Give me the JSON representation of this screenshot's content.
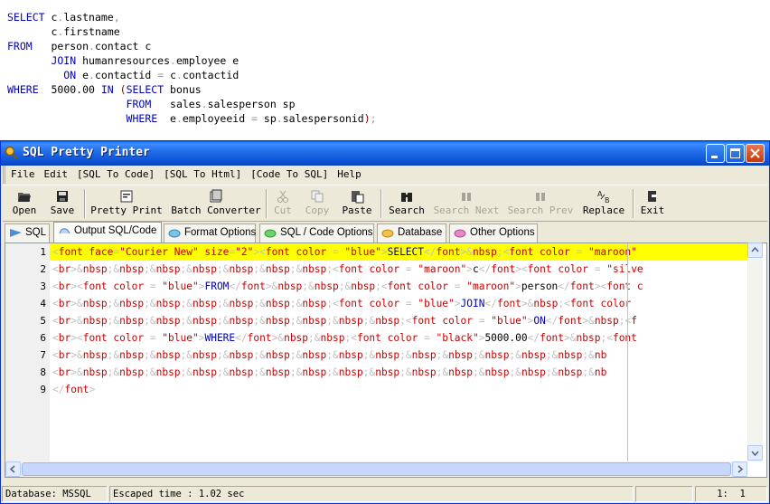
{
  "sql_preview": {
    "lines": [
      [
        {
          "c": "sq-kw",
          "t": "SELECT "
        },
        {
          "c": "sq-id",
          "t": "c"
        },
        {
          "c": "sq-gr",
          "t": "."
        },
        {
          "c": "sq-id",
          "t": "lastname"
        },
        {
          "c": "sq-gr",
          "t": ","
        }
      ],
      [
        {
          "c": "sq-id",
          "t": "       c"
        },
        {
          "c": "sq-gr",
          "t": "."
        },
        {
          "c": "sq-id",
          "t": "firstname"
        }
      ],
      [
        {
          "c": "sq-kw",
          "t": "FROM   "
        },
        {
          "c": "sq-id",
          "t": "person"
        },
        {
          "c": "sq-gr",
          "t": "."
        },
        {
          "c": "sq-id",
          "t": "contact c"
        }
      ],
      [
        {
          "c": "sq-kw",
          "t": "       JOIN "
        },
        {
          "c": "sq-id",
          "t": "humanresources"
        },
        {
          "c": "sq-gr",
          "t": "."
        },
        {
          "c": "sq-id",
          "t": "employee e"
        }
      ],
      [
        {
          "c": "sq-kw",
          "t": "         ON "
        },
        {
          "c": "sq-id",
          "t": "e"
        },
        {
          "c": "sq-gr",
          "t": "."
        },
        {
          "c": "sq-id",
          "t": "contactid "
        },
        {
          "c": "sq-gr",
          "t": "= "
        },
        {
          "c": "sq-id",
          "t": "c"
        },
        {
          "c": "sq-gr",
          "t": "."
        },
        {
          "c": "sq-id",
          "t": "contactid"
        }
      ],
      [
        {
          "c": "sq-kw",
          "t": "WHERE  "
        },
        {
          "c": "sq-id",
          "t": "5000.00 "
        },
        {
          "c": "sq-kw",
          "t": "IN "
        },
        {
          "c": "sq-mr",
          "t": "("
        },
        {
          "c": "sq-kw",
          "t": "SELECT "
        },
        {
          "c": "sq-id",
          "t": "bonus"
        }
      ],
      [
        {
          "c": "sq-kw",
          "t": "                   FROM   "
        },
        {
          "c": "sq-id",
          "t": "sales"
        },
        {
          "c": "sq-gr",
          "t": "."
        },
        {
          "c": "sq-id",
          "t": "salesperson sp"
        }
      ],
      [
        {
          "c": "sq-kw",
          "t": "                   WHERE  "
        },
        {
          "c": "sq-id",
          "t": "e"
        },
        {
          "c": "sq-gr",
          "t": "."
        },
        {
          "c": "sq-id",
          "t": "employeeid "
        },
        {
          "c": "sq-gr",
          "t": "= "
        },
        {
          "c": "sq-id",
          "t": "sp"
        },
        {
          "c": "sq-gr",
          "t": "."
        },
        {
          "c": "sq-id",
          "t": "salespersonid"
        },
        {
          "c": "sq-mr",
          "t": ")"
        },
        {
          "c": "sq-gr",
          "t": ";"
        }
      ]
    ]
  },
  "window": {
    "title": "SQL Pretty Printer",
    "menu": [
      "File",
      "Edit",
      "[SQL To Code]",
      "[SQL To Html]",
      "[Code To SQL]",
      "Help"
    ],
    "toolbar": {
      "open": "Open",
      "save": "Save",
      "pretty_print": "Pretty Print",
      "batch_converter": "Batch Converter",
      "cut": "Cut",
      "copy": "Copy",
      "paste": "Paste",
      "search": "Search",
      "search_next": "Search Next",
      "search_prev": "Search Prev",
      "replace": "Replace",
      "exit": "Exit"
    },
    "tabs": [
      "SQL",
      "Output SQL/Code",
      "Format Options",
      "SQL / Code Options",
      "Database",
      "Other Options"
    ],
    "active_tab": "Output SQL/Code",
    "line_numbers": [
      "1",
      "2",
      "3",
      "4",
      "5",
      "6",
      "7",
      "8",
      "9"
    ],
    "code_lines": [
      [
        {
          "c": "t",
          "t": "<"
        },
        {
          "c": "s",
          "t": "font face"
        },
        {
          "c": "t",
          "t": "="
        },
        {
          "c": "s",
          "t": "\"Courier New\" size"
        },
        {
          "c": "t",
          "t": "="
        },
        {
          "c": "s",
          "t": "\"2\""
        },
        {
          "c": "t",
          "t": ">"
        },
        {
          "c": "t",
          "t": "<"
        },
        {
          "c": "s",
          "t": "font color "
        },
        {
          "c": "t",
          "t": "= "
        },
        {
          "c": "s",
          "t": "\"blue\""
        },
        {
          "c": "t",
          "t": ">"
        },
        {
          "c": "k",
          "t": "SELECT"
        },
        {
          "c": "t",
          "t": "</"
        },
        {
          "c": "s",
          "t": "font"
        },
        {
          "c": "t",
          "t": ">&"
        },
        {
          "c": "s",
          "t": "nbsp"
        },
        {
          "c": "t",
          "t": ";<"
        },
        {
          "c": "s",
          "t": "font color "
        },
        {
          "c": "t",
          "t": "= "
        },
        {
          "c": "s",
          "t": "\"maroon\""
        }
      ],
      [
        {
          "c": "t",
          "t": "<"
        },
        {
          "c": "s",
          "t": "br"
        },
        {
          "c": "t",
          "t": ">&"
        },
        {
          "c": "s",
          "t": "nbsp"
        },
        {
          "c": "t",
          "t": ";&"
        },
        {
          "c": "s",
          "t": "nbsp"
        },
        {
          "c": "t",
          "t": ";&"
        },
        {
          "c": "s",
          "t": "nbsp"
        },
        {
          "c": "t",
          "t": ";&"
        },
        {
          "c": "s",
          "t": "nbsp"
        },
        {
          "c": "t",
          "t": ";&"
        },
        {
          "c": "s",
          "t": "nbsp"
        },
        {
          "c": "t",
          "t": ";&"
        },
        {
          "c": "s",
          "t": "nbsp"
        },
        {
          "c": "t",
          "t": ";&"
        },
        {
          "c": "s",
          "t": "nbsp"
        },
        {
          "c": "t",
          "t": ";<"
        },
        {
          "c": "s",
          "t": "font color "
        },
        {
          "c": "t",
          "t": "= "
        },
        {
          "c": "s",
          "t": "\"maroon\""
        },
        {
          "c": "t",
          "t": ">"
        },
        {
          "c": "v",
          "t": "c"
        },
        {
          "c": "t",
          "t": "</"
        },
        {
          "c": "s",
          "t": "font"
        },
        {
          "c": "t",
          "t": "><"
        },
        {
          "c": "s",
          "t": "font color "
        },
        {
          "c": "t",
          "t": "= "
        },
        {
          "c": "s",
          "t": "\"silve"
        }
      ],
      [
        {
          "c": "t",
          "t": "<"
        },
        {
          "c": "s",
          "t": "br"
        },
        {
          "c": "t",
          "t": "><"
        },
        {
          "c": "s",
          "t": "font color "
        },
        {
          "c": "t",
          "t": "= "
        },
        {
          "c": "s",
          "t": "\"blue\""
        },
        {
          "c": "t",
          "t": ">"
        },
        {
          "c": "k",
          "t": "FROM"
        },
        {
          "c": "t",
          "t": "</"
        },
        {
          "c": "s",
          "t": "font"
        },
        {
          "c": "t",
          "t": ">&"
        },
        {
          "c": "s",
          "t": "nbsp"
        },
        {
          "c": "t",
          "t": ";&"
        },
        {
          "c": "s",
          "t": "nbsp"
        },
        {
          "c": "t",
          "t": ";&"
        },
        {
          "c": "s",
          "t": "nbsp"
        },
        {
          "c": "t",
          "t": ";<"
        },
        {
          "c": "s",
          "t": "font color "
        },
        {
          "c": "t",
          "t": "= "
        },
        {
          "c": "s",
          "t": "\"maroon\""
        },
        {
          "c": "t",
          "t": ">"
        },
        {
          "c": "v",
          "t": "person"
        },
        {
          "c": "t",
          "t": "</"
        },
        {
          "c": "s",
          "t": "font"
        },
        {
          "c": "t",
          "t": "><"
        },
        {
          "c": "s",
          "t": "font c"
        }
      ],
      [
        {
          "c": "t",
          "t": "<"
        },
        {
          "c": "s",
          "t": "br"
        },
        {
          "c": "t",
          "t": ">&"
        },
        {
          "c": "s",
          "t": "nbsp"
        },
        {
          "c": "t",
          "t": ";&"
        },
        {
          "c": "s",
          "t": "nbsp"
        },
        {
          "c": "t",
          "t": ";&"
        },
        {
          "c": "s",
          "t": "nbsp"
        },
        {
          "c": "t",
          "t": ";&"
        },
        {
          "c": "s",
          "t": "nbsp"
        },
        {
          "c": "t",
          "t": ";&"
        },
        {
          "c": "s",
          "t": "nbsp"
        },
        {
          "c": "t",
          "t": ";&"
        },
        {
          "c": "s",
          "t": "nbsp"
        },
        {
          "c": "t",
          "t": ";&"
        },
        {
          "c": "s",
          "t": "nbsp"
        },
        {
          "c": "t",
          "t": ";<"
        },
        {
          "c": "s",
          "t": "font color "
        },
        {
          "c": "t",
          "t": "= "
        },
        {
          "c": "s",
          "t": "\"blue\""
        },
        {
          "c": "t",
          "t": ">"
        },
        {
          "c": "k",
          "t": "JOIN"
        },
        {
          "c": "t",
          "t": "</"
        },
        {
          "c": "s",
          "t": "font"
        },
        {
          "c": "t",
          "t": ">&"
        },
        {
          "c": "s",
          "t": "nbsp"
        },
        {
          "c": "t",
          "t": ";<"
        },
        {
          "c": "s",
          "t": "font color "
        }
      ],
      [
        {
          "c": "t",
          "t": "<"
        },
        {
          "c": "s",
          "t": "br"
        },
        {
          "c": "t",
          "t": ">&"
        },
        {
          "c": "s",
          "t": "nbsp"
        },
        {
          "c": "t",
          "t": ";&"
        },
        {
          "c": "s",
          "t": "nbsp"
        },
        {
          "c": "t",
          "t": ";&"
        },
        {
          "c": "s",
          "t": "nbsp"
        },
        {
          "c": "t",
          "t": ";&"
        },
        {
          "c": "s",
          "t": "nbsp"
        },
        {
          "c": "t",
          "t": ";&"
        },
        {
          "c": "s",
          "t": "nbsp"
        },
        {
          "c": "t",
          "t": ";&"
        },
        {
          "c": "s",
          "t": "nbsp"
        },
        {
          "c": "t",
          "t": ";&"
        },
        {
          "c": "s",
          "t": "nbsp"
        },
        {
          "c": "t",
          "t": ";&"
        },
        {
          "c": "s",
          "t": "nbsp"
        },
        {
          "c": "t",
          "t": ";&"
        },
        {
          "c": "s",
          "t": "nbsp"
        },
        {
          "c": "t",
          "t": ";<"
        },
        {
          "c": "s",
          "t": "font color "
        },
        {
          "c": "t",
          "t": "= "
        },
        {
          "c": "s",
          "t": "\"blue\""
        },
        {
          "c": "t",
          "t": ">"
        },
        {
          "c": "k",
          "t": "ON"
        },
        {
          "c": "t",
          "t": "</"
        },
        {
          "c": "s",
          "t": "font"
        },
        {
          "c": "t",
          "t": ">&"
        },
        {
          "c": "s",
          "t": "nbsp"
        },
        {
          "c": "t",
          "t": ";<"
        },
        {
          "c": "s",
          "t": "f"
        }
      ],
      [
        {
          "c": "t",
          "t": "<"
        },
        {
          "c": "s",
          "t": "br"
        },
        {
          "c": "t",
          "t": "><"
        },
        {
          "c": "s",
          "t": "font color "
        },
        {
          "c": "t",
          "t": "= "
        },
        {
          "c": "s",
          "t": "\"blue\""
        },
        {
          "c": "t",
          "t": ">"
        },
        {
          "c": "k",
          "t": "WHERE"
        },
        {
          "c": "t",
          "t": "</"
        },
        {
          "c": "s",
          "t": "font"
        },
        {
          "c": "t",
          "t": ">&"
        },
        {
          "c": "s",
          "t": "nbsp"
        },
        {
          "c": "t",
          "t": ";&"
        },
        {
          "c": "s",
          "t": "nbsp"
        },
        {
          "c": "t",
          "t": ";<"
        },
        {
          "c": "s",
          "t": "font color "
        },
        {
          "c": "t",
          "t": "= "
        },
        {
          "c": "s",
          "t": "\"black\""
        },
        {
          "c": "t",
          "t": ">"
        },
        {
          "c": "v",
          "t": "5000.00"
        },
        {
          "c": "t",
          "t": "</"
        },
        {
          "c": "s",
          "t": "font"
        },
        {
          "c": "t",
          "t": ">&"
        },
        {
          "c": "s",
          "t": "nbsp"
        },
        {
          "c": "t",
          "t": ";<"
        },
        {
          "c": "s",
          "t": "font "
        }
      ],
      [
        {
          "c": "t",
          "t": "<"
        },
        {
          "c": "s",
          "t": "br"
        },
        {
          "c": "t",
          "t": ">&"
        },
        {
          "c": "s",
          "t": "nbsp"
        },
        {
          "c": "t",
          "t": ";&"
        },
        {
          "c": "s",
          "t": "nbsp"
        },
        {
          "c": "t",
          "t": ";&"
        },
        {
          "c": "s",
          "t": "nbsp"
        },
        {
          "c": "t",
          "t": ";&"
        },
        {
          "c": "s",
          "t": "nbsp"
        },
        {
          "c": "t",
          "t": ";&"
        },
        {
          "c": "s",
          "t": "nbsp"
        },
        {
          "c": "t",
          "t": ";&"
        },
        {
          "c": "s",
          "t": "nbsp"
        },
        {
          "c": "t",
          "t": ";&"
        },
        {
          "c": "s",
          "t": "nbsp"
        },
        {
          "c": "t",
          "t": ";&"
        },
        {
          "c": "s",
          "t": "nbsp"
        },
        {
          "c": "t",
          "t": ";&"
        },
        {
          "c": "s",
          "t": "nbsp"
        },
        {
          "c": "t",
          "t": ";&"
        },
        {
          "c": "s",
          "t": "nbsp"
        },
        {
          "c": "t",
          "t": ";&"
        },
        {
          "c": "s",
          "t": "nbsp"
        },
        {
          "c": "t",
          "t": ";&"
        },
        {
          "c": "s",
          "t": "nbsp"
        },
        {
          "c": "t",
          "t": ";&"
        },
        {
          "c": "s",
          "t": "nbsp"
        },
        {
          "c": "t",
          "t": ";&"
        },
        {
          "c": "s",
          "t": "nbsp"
        },
        {
          "c": "t",
          "t": ";&"
        },
        {
          "c": "s",
          "t": "nb"
        }
      ],
      [
        {
          "c": "t",
          "t": "<"
        },
        {
          "c": "s",
          "t": "br"
        },
        {
          "c": "t",
          "t": ">&"
        },
        {
          "c": "s",
          "t": "nbsp"
        },
        {
          "c": "t",
          "t": ";&"
        },
        {
          "c": "s",
          "t": "nbsp"
        },
        {
          "c": "t",
          "t": ";&"
        },
        {
          "c": "s",
          "t": "nbsp"
        },
        {
          "c": "t",
          "t": ";&"
        },
        {
          "c": "s",
          "t": "nbsp"
        },
        {
          "c": "t",
          "t": ";&"
        },
        {
          "c": "s",
          "t": "nbsp"
        },
        {
          "c": "t",
          "t": ";&"
        },
        {
          "c": "s",
          "t": "nbsp"
        },
        {
          "c": "t",
          "t": ";&"
        },
        {
          "c": "s",
          "t": "nbsp"
        },
        {
          "c": "t",
          "t": ";&"
        },
        {
          "c": "s",
          "t": "nbsp"
        },
        {
          "c": "t",
          "t": ";&"
        },
        {
          "c": "s",
          "t": "nbsp"
        },
        {
          "c": "t",
          "t": ";&"
        },
        {
          "c": "s",
          "t": "nbsp"
        },
        {
          "c": "t",
          "t": ";&"
        },
        {
          "c": "s",
          "t": "nbsp"
        },
        {
          "c": "t",
          "t": ";&"
        },
        {
          "c": "s",
          "t": "nbsp"
        },
        {
          "c": "t",
          "t": ";&"
        },
        {
          "c": "s",
          "t": "nbsp"
        },
        {
          "c": "t",
          "t": ";&"
        },
        {
          "c": "s",
          "t": "nbsp"
        },
        {
          "c": "t",
          "t": ";&"
        },
        {
          "c": "s",
          "t": "nb"
        }
      ],
      [
        {
          "c": "t",
          "t": "</"
        },
        {
          "c": "s",
          "t": "font"
        },
        {
          "c": "t",
          "t": ">"
        }
      ]
    ],
    "status": {
      "database": "Database: MSSQL",
      "escaped": "Escaped time : 1.02 sec",
      "empty": "",
      "position": "1:  1"
    }
  },
  "colors": {
    "title_bar": "#0a5ff0",
    "current_line": "#ffff00",
    "keyword": "#0000c0",
    "tag": "#c80000",
    "punct": "#c0c0c0"
  }
}
